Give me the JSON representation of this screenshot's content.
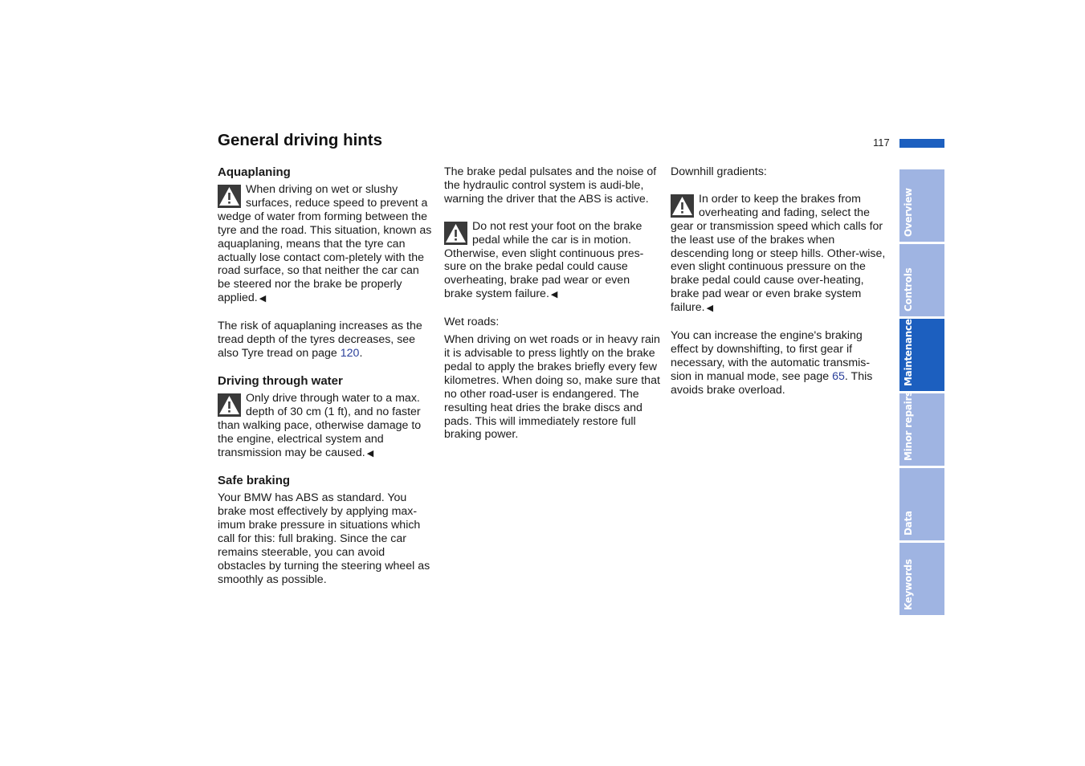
{
  "page": {
    "title": "General driving hints",
    "page_number": "117",
    "accent_color": "#1c5fbf",
    "tab_color": "#9fb4e2"
  },
  "columns": {
    "col1": {
      "aquaplaning_heading": "Aquaplaning",
      "aquaplaning_warning": "When driving on wet or slushy surfaces, reduce speed to prevent a wedge of water from forming between the tyre and the road. This situation, known as aquaplaning, means that the tyre can actually lose contact com-pletely with the road surface, so that neither the car can be steered nor the brake be properly applied.",
      "aquaplaning_risk_text": "The risk of aquaplaning increases as the tread depth of the tyres decreases, see also Tyre tread on page ",
      "aquaplaning_risk_link": "120",
      "aquaplaning_risk_end": ".",
      "water_heading": "Driving through water",
      "water_warning": "Only drive through water to a max. depth of 30 cm (1 ft), and no faster than walking pace, otherwise damage to the engine, electrical system and transmission may be caused.",
      "braking_heading": "Safe braking",
      "braking_text": "Your BMW has ABS as standard. You brake most effectively by applying max-imum brake pressure in situations which call for this: full braking. Since the car remains steerable, you can avoid obstacles by turning the steering wheel as smoothly as possible."
    },
    "col2": {
      "abs_text": "The brake pedal pulsates and the noise of the hydraulic control system is audi-ble, warning the driver that the ABS is active.",
      "foot_warning": "Do not rest your foot on the brake pedal while the car is in motion. Otherwise, even slight continuous pres-sure on the brake pedal could cause overheating, brake pad wear or even brake system failure.",
      "wet_heading": "Wet roads:",
      "wet_text": "When driving on wet roads or in heavy rain it is advisable to press lightly on the brake pedal to apply the brakes briefly every few kilometres. When doing so, make sure that no other road-user is endangered. The resulting heat dries the brake discs and pads. This will immediately restore full braking power."
    },
    "col3": {
      "downhill_heading": "Downhill gradients:",
      "downhill_warning": "In order to keep the brakes from overheating and fading, select the gear or transmission speed which calls for the least use of the brakes when descending long or steep hills. Other-wise, even slight continuous pressure on the brake pedal could cause over-heating, brake pad wear or even brake system failure.",
      "engine_brake_text": "You can increase the engine's braking effect by downshifting, to first gear if necessary, with the automatic transmis-sion in manual mode, see page ",
      "engine_brake_link": "65",
      "engine_brake_end": ". This avoids brake overload."
    }
  },
  "end_mark": "◀",
  "tabs": [
    {
      "label": "Overview",
      "active": false
    },
    {
      "label": "Controls",
      "active": false
    },
    {
      "label": "Maintenance",
      "active": true
    },
    {
      "label": "Minor repairs",
      "active": false
    },
    {
      "label": "Data",
      "active": false
    },
    {
      "label": "Keywords",
      "active": false
    }
  ]
}
